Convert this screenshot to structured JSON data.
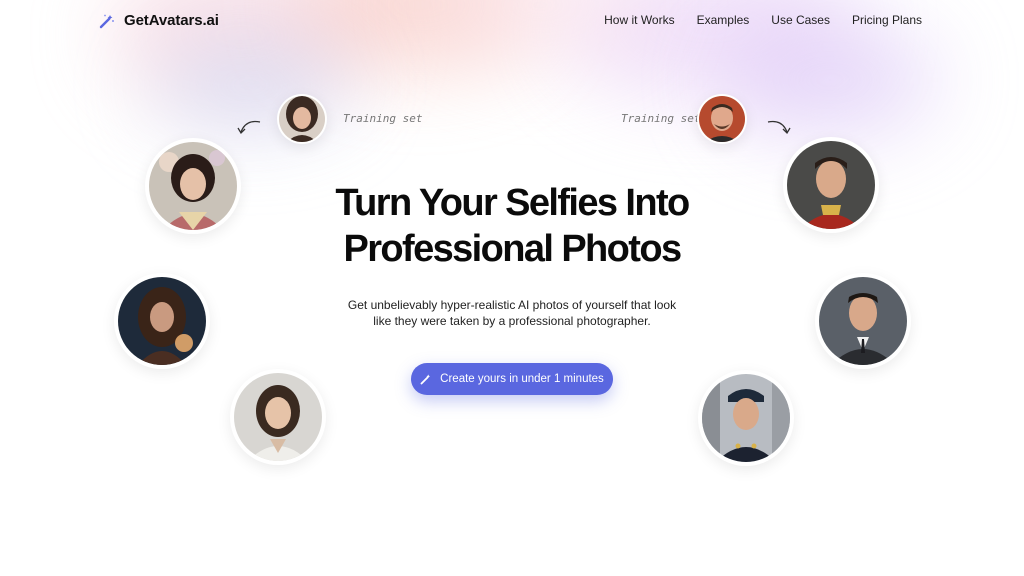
{
  "brand": {
    "name": "GetAvatars.ai",
    "accent": "#5a67e0"
  },
  "nav": [
    {
      "label": "How it Works"
    },
    {
      "label": "Examples"
    },
    {
      "label": "Use Cases"
    },
    {
      "label": "Pricing Plans"
    }
  ],
  "hero": {
    "title_line1": "Turn Your Selfies Into",
    "title_line2": "Professional Photos",
    "subtitle_line1": "Get unbelievably hyper-realistic AI photos of yourself that look",
    "subtitle_line2": "like they were taken by a professional photographer.",
    "cta_label": "Create yours in under 1 minutes"
  },
  "training": {
    "left_label": "Training set",
    "right_label": "Training set"
  }
}
